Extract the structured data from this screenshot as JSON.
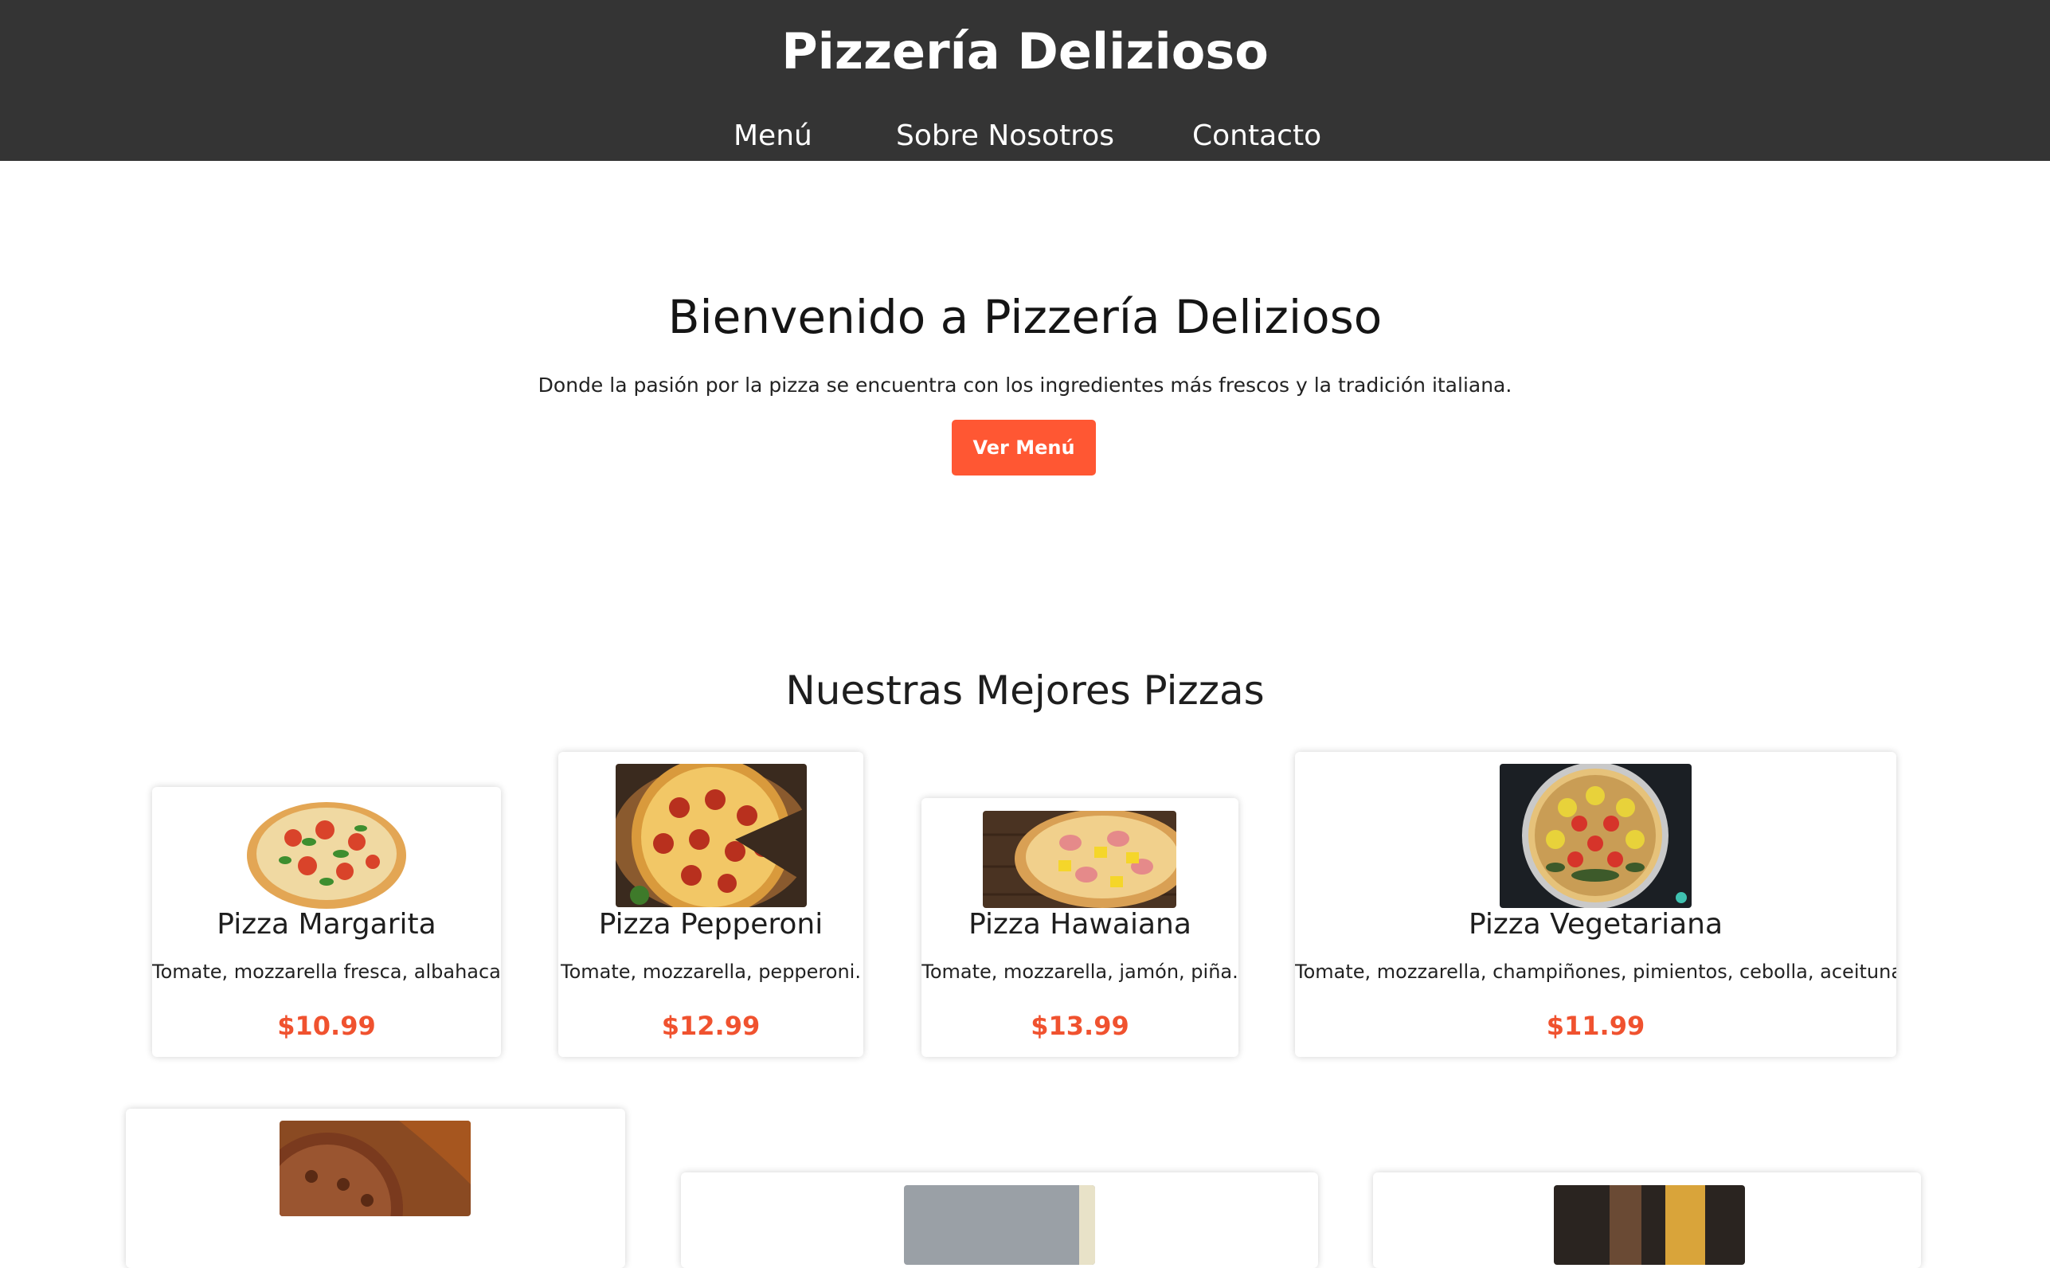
{
  "header": {
    "title": "Pizzería Delizioso",
    "nav": [
      "Menú",
      "Sobre Nosotros",
      "Contacto"
    ]
  },
  "hero": {
    "title": "Bienvenido a Pizzería Delizioso",
    "subtitle": "Donde la pasión por la pizza se encuentra con los ingredientes más frescos y la tradición italiana.",
    "button": "Ver Menú"
  },
  "menu": {
    "title": "Nuestras Mejores Pizzas",
    "items": [
      {
        "name": "Pizza Margarita",
        "desc": "Tomate, mozzarella fresca, albahaca.",
        "price": "$10.99",
        "image": "pizza-margarita-photo"
      },
      {
        "name": "Pizza Pepperoni",
        "desc": "Tomate, mozzarella, pepperoni.",
        "price": "$12.99",
        "image": "pizza-pepperoni-photo"
      },
      {
        "name": "Pizza Hawaiana",
        "desc": "Tomate, mozzarella, jamón, piña.",
        "price": "$13.99",
        "image": "pizza-hawaiana-photo"
      },
      {
        "name": "Pizza Vegetariana",
        "desc": "Tomate, mozzarella, champiñones, pimientos, cebolla, aceitunas.",
        "price": "$11.99",
        "image": "pizza-vegetariana-photo"
      }
    ]
  },
  "colors": {
    "header_bg": "#343434",
    "accent": "#ff5733",
    "price": "#f0522f"
  }
}
